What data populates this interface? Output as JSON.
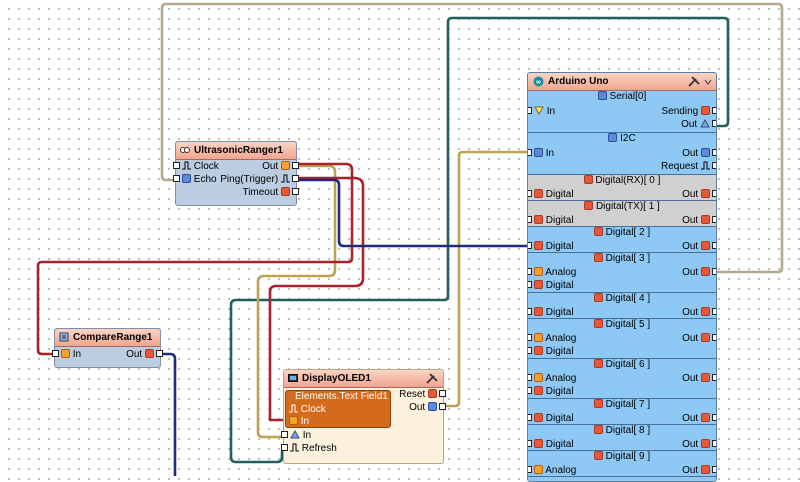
{
  "colors": {
    "wire_red": "#a8232a",
    "wire_yellow": "#bfa355",
    "wire_navy": "#1f2a7f",
    "wire_teal": "#21605f",
    "wire_gray": "#b3aa8d",
    "component_body": "#bccde2",
    "arduino_body": "#8ec9f5",
    "header": "#f0a590"
  },
  "ultrasonic": {
    "title": "UltrasonicRanger1",
    "clock": "Clock",
    "echo": "Echo",
    "out": "Out",
    "ping": "Ping(Trigger)",
    "timeout": "Timeout"
  },
  "compare": {
    "title": "CompareRange1",
    "in": "In",
    "out": "Out"
  },
  "oled": {
    "title": "DisplayOLED1",
    "field_title": "Elements.Text Field1",
    "field_clock": "Clock",
    "field_in": "In",
    "in": "In",
    "refresh": "Refresh",
    "reset": "Reset",
    "out": "Out"
  },
  "arduino": {
    "title": "Arduino Uno",
    "serial_title": "Serial[0]",
    "serial_in": "In",
    "serial_sending": "Sending",
    "serial_out": "Out",
    "i2c_title": "I2C",
    "i2c_in": "In",
    "i2c_out": "Out",
    "i2c_request": "Request",
    "sections": [
      {
        "title": "Digital(RX)[ 0 ]",
        "left": [
          "Digital"
        ],
        "out": "Out",
        "gray": true
      },
      {
        "title": "Digital(TX)[ 1 ]",
        "left": [
          "Digital"
        ],
        "out": "Out",
        "gray": true
      },
      {
        "title": "Digital[ 2 ]",
        "left": [
          "Digital"
        ],
        "out": "Out",
        "gray": false
      },
      {
        "title": "Digital[ 3 ]",
        "left": [
          "Analog",
          "Digital"
        ],
        "out": "Out",
        "gray": false
      },
      {
        "title": "Digital[ 4 ]",
        "left": [
          "Digital"
        ],
        "out": "Out",
        "gray": false
      },
      {
        "title": "Digital[ 5 ]",
        "left": [
          "Analog",
          "Digital"
        ],
        "out": "Out",
        "gray": false
      },
      {
        "title": "Digital[ 6 ]",
        "left": [
          "Analog",
          "Digital"
        ],
        "out": "Out",
        "gray": false
      },
      {
        "title": "Digital[ 7 ]",
        "left": [
          "Digital"
        ],
        "out": "Out",
        "gray": false
      },
      {
        "title": "Digital[ 8 ]",
        "left": [
          "Digital"
        ],
        "out": "Out",
        "gray": false
      },
      {
        "title": "Digital[ 9 ]",
        "left": [
          "Analog"
        ],
        "out": "Out",
        "gray": false
      }
    ]
  }
}
